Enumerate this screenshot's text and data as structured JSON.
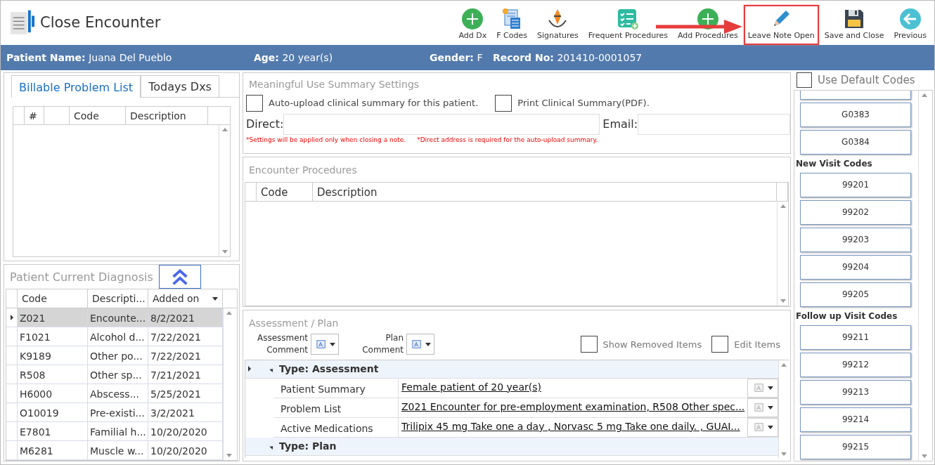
{
  "window": {
    "title": "Close Encounter"
  },
  "toolbar": [
    {
      "label": "Add Dx",
      "kind": "plus",
      "highlighted": false
    },
    {
      "label": "F Codes",
      "kind": "calculator",
      "highlighted": false
    },
    {
      "label": "Signatures",
      "kind": "pen",
      "highlighted": false
    },
    {
      "label": "Frequent Procedures",
      "kind": "checklist",
      "highlighted": false
    },
    {
      "label": "Add Procedures",
      "kind": "plus",
      "highlighted": false
    },
    {
      "label": "Leave Note Open",
      "kind": "pencil",
      "highlighted": true
    },
    {
      "label": "Save and Close",
      "kind": "floppy",
      "highlighted": false
    },
    {
      "label": "Previous",
      "kind": "back",
      "highlighted": false
    }
  ],
  "patient": [
    {
      "label": "Patient Name:",
      "value": "Juana Del Pueblo"
    },
    {
      "label": "Age:",
      "value": "20 year(s)"
    },
    {
      "label": "Gender:",
      "value": "F"
    },
    {
      "label": "Record No:",
      "value": "201410-0001057"
    }
  ],
  "problem_tabs": [
    {
      "label": "Billable Problem List",
      "selected": true
    },
    {
      "label": "Todays Dxs",
      "selected": false
    }
  ],
  "problem_table": {
    "columns": [
      "#",
      "Code",
      "Description"
    ]
  },
  "current_diagnosis": {
    "title": "Patient Current Diagnosis",
    "columns": [
      {
        "label": "Code",
        "sorted": false
      },
      {
        "label": "Descripti...",
        "sorted": false
      },
      {
        "label": "Added on",
        "sorted": true
      }
    ],
    "rows": [
      {
        "code": "Z021",
        "description": "Encounte...",
        "added": "8/2/2021",
        "selected": true
      },
      {
        "code": "F1021",
        "description": "Alcohol d...",
        "added": "7/22/2021",
        "selected": false
      },
      {
        "code": "K9189",
        "description": "Other po...",
        "added": "7/22/2021",
        "selected": false
      },
      {
        "code": "R508",
        "description": "Other sp...",
        "added": "7/21/2021",
        "selected": false
      },
      {
        "code": "H6000",
        "description": "Abscess...",
        "added": "5/25/2021",
        "selected": false
      },
      {
        "code": "O10019",
        "description": "Pre-existi...",
        "added": "3/2/2021",
        "selected": false
      },
      {
        "code": "E7801",
        "description": "Familial h...",
        "added": "10/20/2020",
        "selected": false
      },
      {
        "code": "M6281",
        "description": "Muscle w...",
        "added": "10/20/2020",
        "selected": false
      }
    ]
  },
  "meaningful_use": {
    "title": "Meaningful Use Summary Settings",
    "checkboxes": [
      {
        "label": "Auto-upload clinical summary for this patient.",
        "checked": false
      },
      {
        "label": "Print Clinical Summary(PDF).",
        "checked": false
      }
    ],
    "direct_label": "Direct:",
    "email_label": "Email:",
    "notes": [
      "*Settings will be applied only when closing a note.",
      "*Direct address is required for the auto-upload summary."
    ]
  },
  "encounter_procedures": {
    "title": "Encounter Procedures",
    "columns": [
      "Code",
      "Description"
    ]
  },
  "assessment_plan": {
    "title": "Assessment / Plan",
    "comment_buttons": [
      "Assessment Comment",
      "Plan Comment"
    ],
    "checkboxes": [
      {
        "label": "Show Removed Items",
        "checked": false
      },
      {
        "label": "Edit Items",
        "checked": false
      }
    ],
    "groups": [
      {
        "label": "Type: Assessment",
        "expanded": true,
        "rows": [
          {
            "label": "Patient Summary",
            "value": "Female patient of 20 year(s)"
          },
          {
            "label": "Problem List",
            "value": "Z021 Encounter for pre-employment examination, R508 Other spec..."
          },
          {
            "label": "Active Medications",
            "value": "Trilipix 45 mg Take one a day , Norvasc 5 mg Take one daily.  , GUAI..."
          }
        ]
      },
      {
        "label": "Type: Plan",
        "expanded": true
      }
    ]
  },
  "codes_panel": {
    "use_default": {
      "label": "Use Default Codes",
      "checked": false
    },
    "sections": [
      {
        "codes": [
          "G0383",
          "G0384"
        ]
      },
      {
        "heading": "New Visit Codes",
        "codes": [
          "99201",
          "99202",
          "99203",
          "99204",
          "99205"
        ]
      },
      {
        "heading": "Follow up Visit Codes",
        "codes": [
          "99211",
          "99212",
          "99213",
          "99214",
          "99215"
        ]
      }
    ]
  }
}
